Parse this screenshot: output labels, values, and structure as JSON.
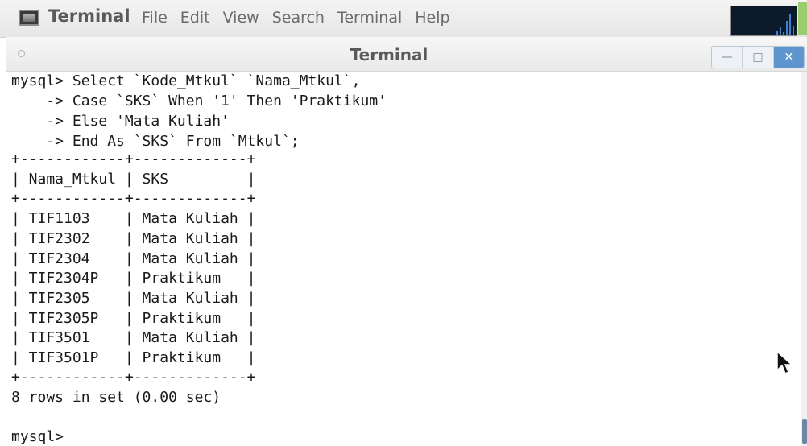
{
  "menubar": {
    "app_title": "Terminal",
    "items": [
      "File",
      "Edit",
      "View",
      "Search",
      "Terminal",
      "Help"
    ]
  },
  "window": {
    "title": "Terminal",
    "controls": {
      "minimize": "—",
      "maximize": "□",
      "close": "✕"
    }
  },
  "terminal": {
    "lines": [
      "mysql> Select `Kode_Mtkul` `Nama_Mtkul`,",
      "    -> Case `SKS` When '1' Then 'Praktikum'",
      "    -> Else 'Mata Kuliah'",
      "    -> End As `SKS` From `Mtkul`;",
      "+------------+-------------+",
      "| Nama_Mtkul | SKS         |",
      "+------------+-------------+",
      "| TIF1103    | Mata Kuliah |",
      "| TIF2302    | Mata Kuliah |",
      "| TIF2304    | Mata Kuliah |",
      "| TIF2304P   | Praktikum   |",
      "| TIF2305    | Mata Kuliah |",
      "| TIF2305P   | Praktikum   |",
      "| TIF3501    | Mata Kuliah |",
      "| TIF3501P   | Praktikum   |",
      "+------------+-------------+",
      "8 rows in set (0.00 sec)",
      "",
      "mysql> "
    ]
  },
  "icons": {
    "app": "terminal-icon",
    "monitor": "system-monitor-icon",
    "cursor": "mouse-pointer-icon"
  },
  "colors": {
    "text": "#1a1a1a",
    "close_button": "#5f95cf",
    "menu_text": "#6b6b6b"
  }
}
